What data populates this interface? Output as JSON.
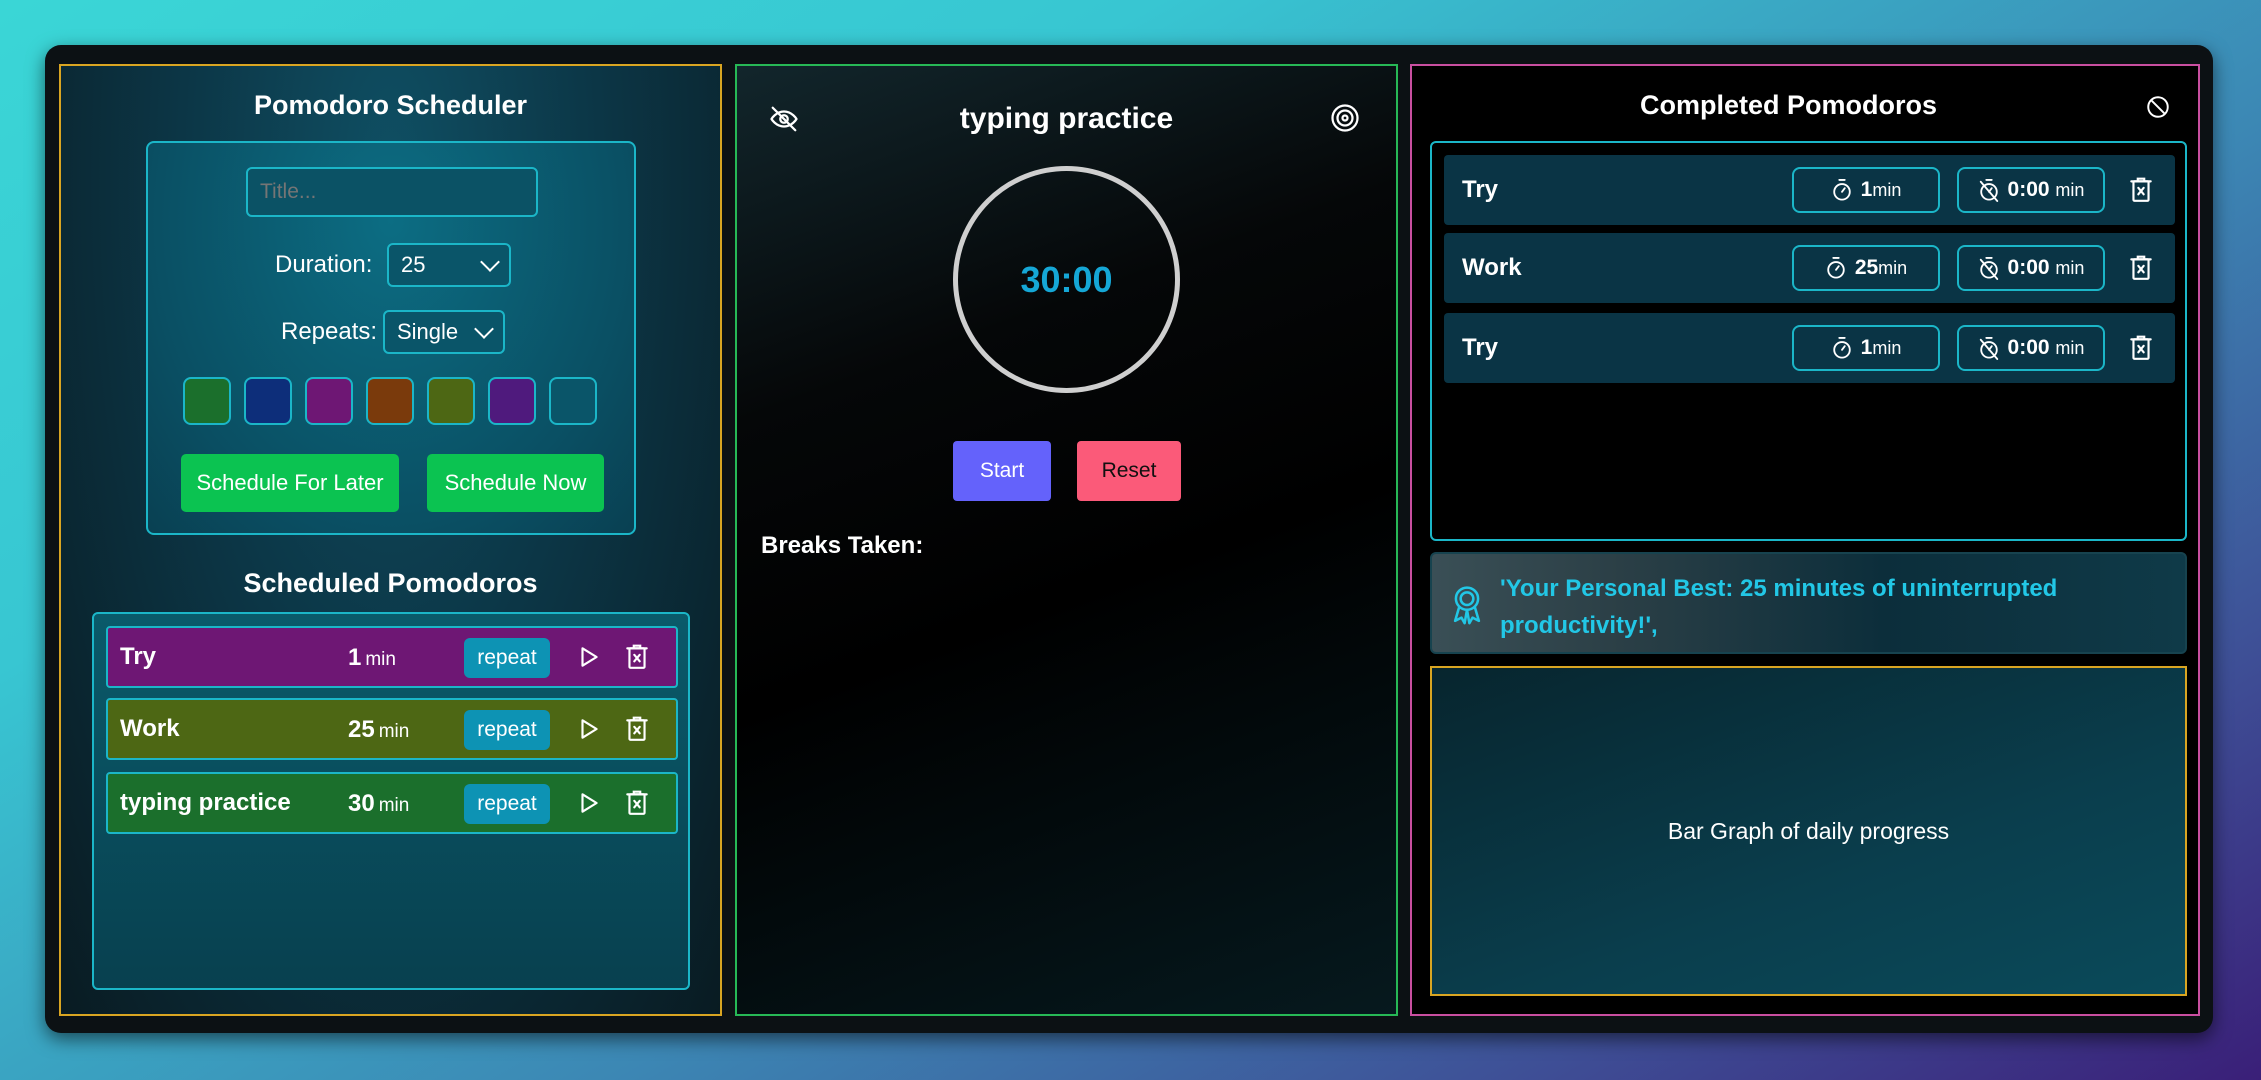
{
  "scheduler": {
    "heading": "Pomodoro Scheduler",
    "title_placeholder": "Title...",
    "duration_label": "Duration:",
    "duration_value": "25",
    "repeats_label": "Repeats:",
    "repeats_value": "Single",
    "colors": [
      "#1b6f2c",
      "#0d2e7a",
      "#6e1774",
      "#7a3a0c",
      "#4d6714",
      "#4f1a7d",
      "#0a5569"
    ],
    "schedule_later_label": "Schedule For Later",
    "schedule_now_label": "Schedule Now"
  },
  "scheduled": {
    "heading": "Scheduled Pomodoros",
    "items": [
      {
        "title": "Try",
        "duration": "1",
        "unit": "min",
        "repeat_label": "repeat",
        "color": "#6e1774"
      },
      {
        "title": "Work",
        "duration": "25",
        "unit": "min",
        "repeat_label": "repeat",
        "color": "#4d6714"
      },
      {
        "title": "typing practice",
        "duration": "30",
        "unit": "min",
        "repeat_label": "repeat",
        "color": "#1b6f2c"
      }
    ]
  },
  "timer": {
    "title": "typing practice",
    "time": "30:00",
    "start_label": "Start",
    "reset_label": "Reset",
    "breaks_label": "Breaks Taken:"
  },
  "completed": {
    "heading": "Completed Pomodoros",
    "items": [
      {
        "title": "Try",
        "duration": "1",
        "unit": "min",
        "break_time": "0:00",
        "break_unit": "min"
      },
      {
        "title": "Work",
        "duration": "25",
        "unit": "min",
        "break_time": "0:00",
        "break_unit": "min"
      },
      {
        "title": "Try",
        "duration": "1",
        "unit": "min",
        "break_time": "0:00",
        "break_unit": "min"
      }
    ],
    "personal_best": "'Your Personal Best: 25 minutes of uninterrupted productivity!',",
    "graph_placeholder": "Bar Graph of daily progress"
  },
  "colors": {
    "start_button": "#6462fb",
    "reset_button": "#fb5a79",
    "green_button": "#0bc351",
    "accent": "#1bb6c8",
    "timer_text": "#15a7d6"
  }
}
